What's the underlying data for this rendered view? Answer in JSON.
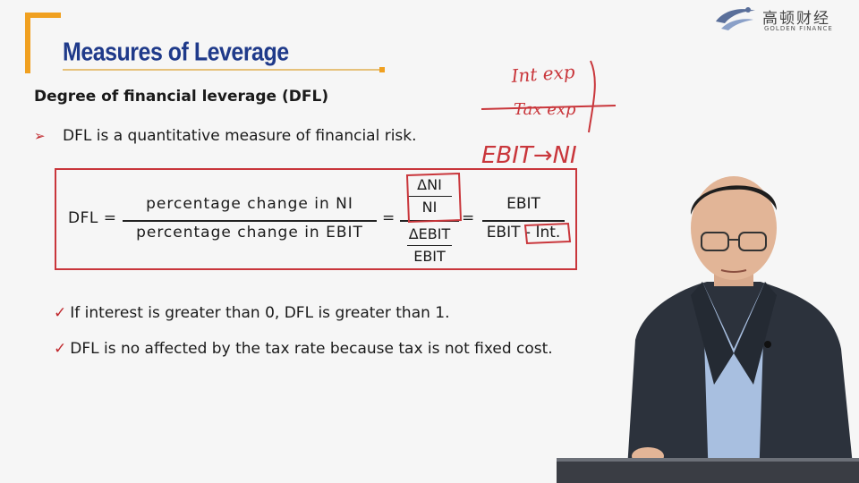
{
  "slide": {
    "title": "Measures of Leverage",
    "subtitle": "Degree of financial leverage (DFL)",
    "bullet": "DFL is a quantitative measure of financial risk.",
    "formula": {
      "label": "DFL =",
      "frac1_num": "percentage change in NI",
      "frac1_den": "percentage change in EBIT",
      "eq": "=",
      "frac2_num_top": "ΔNI",
      "frac2_num_bottom": "NI",
      "frac2_den_top": "ΔEBIT",
      "frac2_den_bottom": "EBIT",
      "frac3_num": "EBIT",
      "frac3_den_a": "EBIT - ",
      "frac3_den_b": "Int."
    },
    "checks": [
      "If interest is greater than 0, DFL is greater than 1.",
      "DFL is no affected by the tax rate because tax is not fixed cost."
    ],
    "check_mark": "✓",
    "bullet_mark": "➢"
  },
  "logo": {
    "cn": "高顿财经",
    "en": "GOLDEN FINANCE"
  },
  "handwriting": {
    "line1": "Int exp",
    "line2": "Tax exp",
    "line3": "EBIT→NI"
  },
  "colors": {
    "title": "#1f3a8a",
    "accent": "#f0a020",
    "annotation_red": "#c9363b"
  }
}
